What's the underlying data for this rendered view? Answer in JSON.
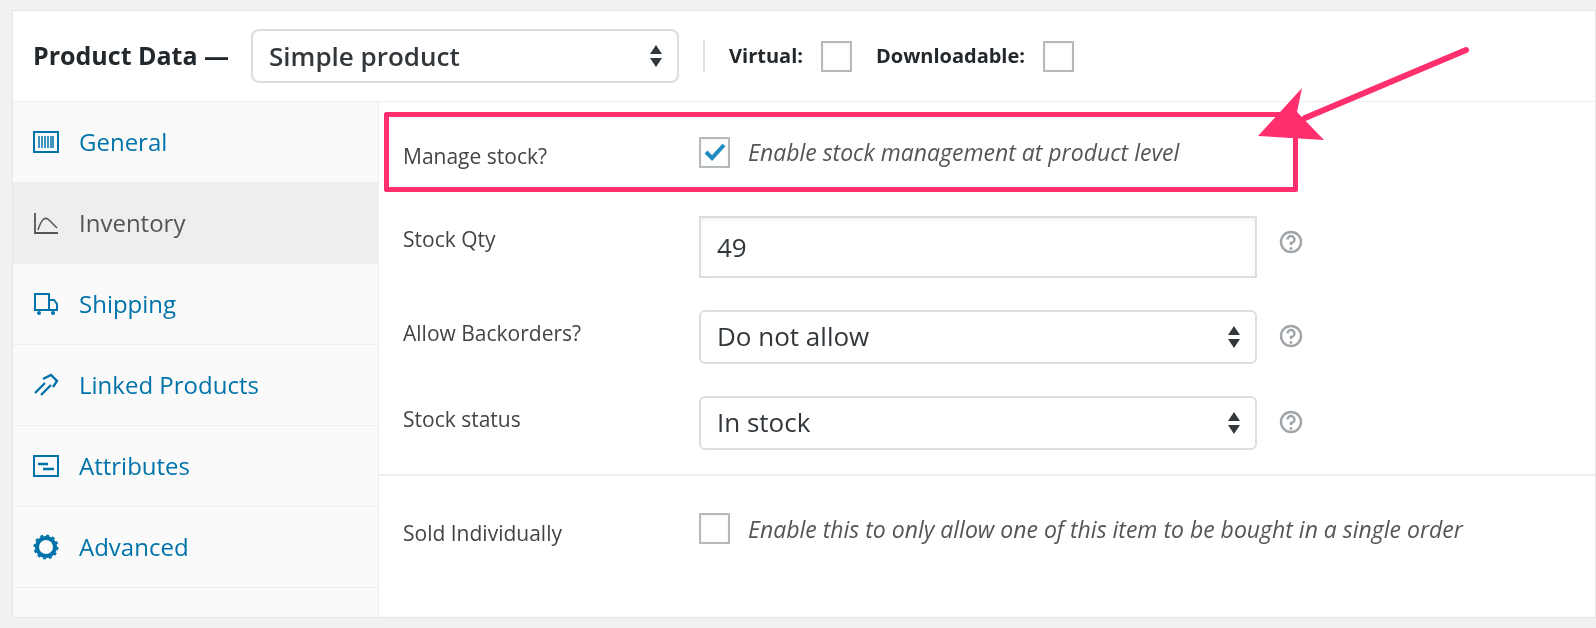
{
  "header": {
    "title": "Product Data —",
    "product_type": "Simple product",
    "options": [
      {
        "label": "Virtual:",
        "checked": false
      },
      {
        "label": "Downloadable:",
        "checked": false
      }
    ]
  },
  "tabs": [
    {
      "label": "General",
      "selected": false
    },
    {
      "label": "Inventory",
      "selected": true
    },
    {
      "label": "Shipping",
      "selected": false
    },
    {
      "label": "Linked Products",
      "selected": false
    },
    {
      "label": "Attributes",
      "selected": false
    },
    {
      "label": "Advanced",
      "selected": false
    }
  ],
  "sections": [
    {
      "fields": [
        {
          "kind": "checkbox",
          "label": "Manage stock?",
          "checked": true,
          "description": "Enable stock management at product level",
          "highlighted": true
        },
        {
          "kind": "text",
          "label": "Stock Qty",
          "value": "49",
          "help": true
        },
        {
          "kind": "select",
          "label": "Allow Backorders?",
          "value": "Do not allow",
          "help": true
        },
        {
          "kind": "select",
          "label": "Stock status",
          "value": "In stock",
          "help": true
        }
      ]
    },
    {
      "fields": [
        {
          "kind": "checkbox",
          "label": "Sold Individually",
          "checked": false,
          "description": "Enable this to only allow one of this item to be bought in a single order",
          "highlighted": false
        }
      ]
    }
  ]
}
